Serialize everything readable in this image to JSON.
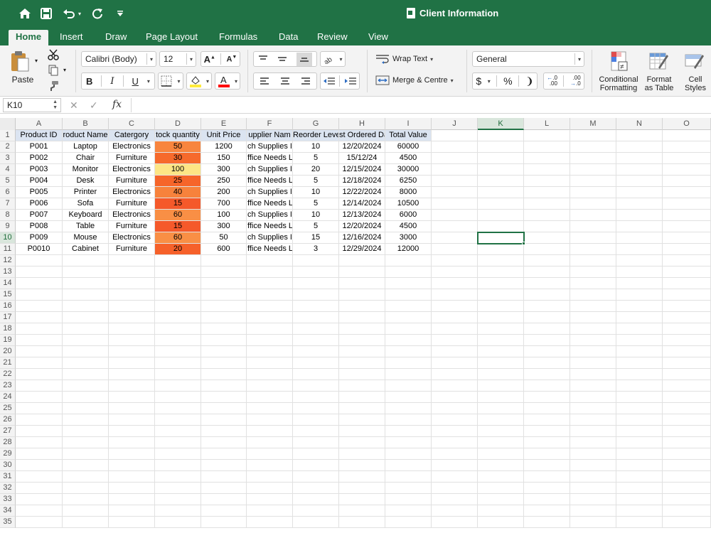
{
  "window": {
    "title": "Client Information"
  },
  "quick_access": [
    {
      "name": "home-icon",
      "glyph": "⌂"
    },
    {
      "name": "save-icon",
      "glyph": "🖫"
    },
    {
      "name": "undo-icon",
      "glyph": "↶"
    },
    {
      "name": "redo-icon",
      "glyph": "↻"
    },
    {
      "name": "customize-toolbar-icon",
      "glyph": "⩡"
    }
  ],
  "tabs": [
    "Home",
    "Insert",
    "Draw",
    "Page Layout",
    "Formulas",
    "Data",
    "Review",
    "View"
  ],
  "ribbon": {
    "paste_label": "Paste",
    "font_name": "Calibri (Body)",
    "font_size": "12",
    "bold": "B",
    "italic": "I",
    "underline": "U",
    "wrap_text": "Wrap Text",
    "merge_centre": "Merge & Centre",
    "number_format": "General",
    "currency": "$",
    "percent": "%",
    "comma": "❩",
    "inc_decimal": ".00",
    "dec_decimal": ".00",
    "conditional_formatting": [
      "Conditional",
      "Formatting"
    ],
    "format_as_table": [
      "Format",
      "as Table"
    ],
    "cell_styles": [
      "Cell",
      "Styles"
    ],
    "accent_color": "#207245",
    "highlight_color": "#ffeb3b",
    "font_color": "#ff0000"
  },
  "formula_bar": {
    "name_box": "K10",
    "fx": "fx",
    "value": ""
  },
  "columns": [
    "A",
    "B",
    "C",
    "D",
    "E",
    "F",
    "G",
    "H",
    "I",
    "J",
    "K",
    "L",
    "M",
    "N",
    "O"
  ],
  "selected_cell": {
    "column": "K",
    "row": 10
  },
  "table": {
    "headers": [
      "Product ID",
      "Product Name",
      "Catergory",
      "Stock quantity",
      "Unit Price",
      "Supplier Name",
      "Reorder Level",
      "Last Ordered Date",
      "Total Value"
    ],
    "header_display": [
      "Product ID",
      "roduct Name",
      "Catergory",
      "tock quantity",
      "Unit Price",
      "upplier Nam",
      "Reorder Leve",
      "st Ordered Da",
      "Total Value"
    ],
    "rows": [
      [
        "P001",
        "Laptop",
        "Electronics",
        "50",
        "1200",
        "ch Supplies In",
        "10",
        "12/20/2024",
        "60000"
      ],
      [
        "P002",
        "Chair",
        "Furniture",
        "30",
        "150",
        "ffice Needs L",
        "5",
        "15/12/24",
        "4500"
      ],
      [
        "P003",
        "Monitor",
        "Electronics",
        "100",
        "300",
        "ch Supplies In",
        "20",
        "12/15/2024",
        "30000"
      ],
      [
        "P004",
        "Desk",
        "Furniture",
        "25",
        "250",
        "ffice Needs L",
        "5",
        "12/18/2024",
        "6250"
      ],
      [
        "P005",
        "Printer",
        "Electronics",
        "40",
        "200",
        "ch Supplies In",
        "10",
        "12/22/2024",
        "8000"
      ],
      [
        "P006",
        "Sofa",
        "Furniture",
        "15",
        "700",
        "ffice Needs L",
        "5",
        "12/14/2024",
        "10500"
      ],
      [
        "P007",
        "Keyboard",
        "Electronics",
        "60",
        "100",
        "ch Supplies In",
        "10",
        "12/13/2024",
        "6000"
      ],
      [
        "P008",
        "Table",
        "Furniture",
        "15",
        "300",
        "ffice Needs L",
        "5",
        "12/20/2024",
        "4500"
      ],
      [
        "P009",
        "Mouse",
        "Electronics",
        "60",
        "50",
        "ch Supplies In",
        "15",
        "12/16/2024",
        "3000"
      ],
      [
        "P0010",
        "Cabinet",
        "Furniture",
        "20",
        "600",
        "ffice Needs L",
        "3",
        "12/29/2024",
        "12000"
      ]
    ],
    "stock_colors": [
      "#f8853e",
      "#f66a2c",
      "#fde585",
      "#f6652a",
      "#f7823c",
      "#f5592a",
      "#f98f45",
      "#f5592a",
      "#f98f45",
      "#f6612a"
    ],
    "header_fill": "#dbe4f1"
  },
  "row_count": 35
}
